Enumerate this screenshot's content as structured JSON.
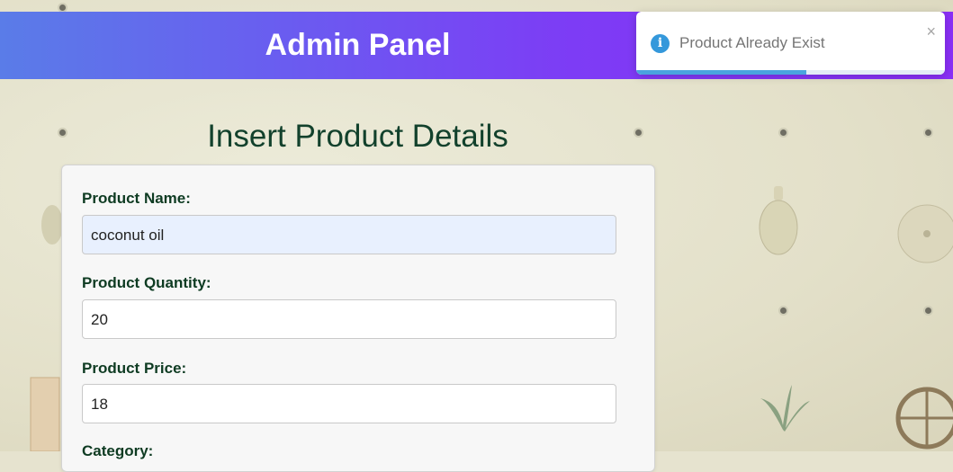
{
  "header": {
    "title": "Admin Panel"
  },
  "page": {
    "section_title": "Insert Product Details"
  },
  "form": {
    "product_name": {
      "label": "Product Name:",
      "value": "coconut oil"
    },
    "product_quantity": {
      "label": "Product Quantity:",
      "value": "20"
    },
    "product_price": {
      "label": "Product Price:",
      "value": "18"
    },
    "category": {
      "label": "Category:"
    }
  },
  "toast": {
    "message": "Product Already Exist",
    "close_glyph": "×",
    "info_glyph": "i",
    "icon": "info-icon",
    "progress_fraction": 0.55,
    "color": "#3498db"
  },
  "colors": {
    "header_gradient": [
      "#5a7ce8",
      "#8a2ff6"
    ],
    "label_color": "#0e3b22",
    "title_color": "#12412c"
  }
}
